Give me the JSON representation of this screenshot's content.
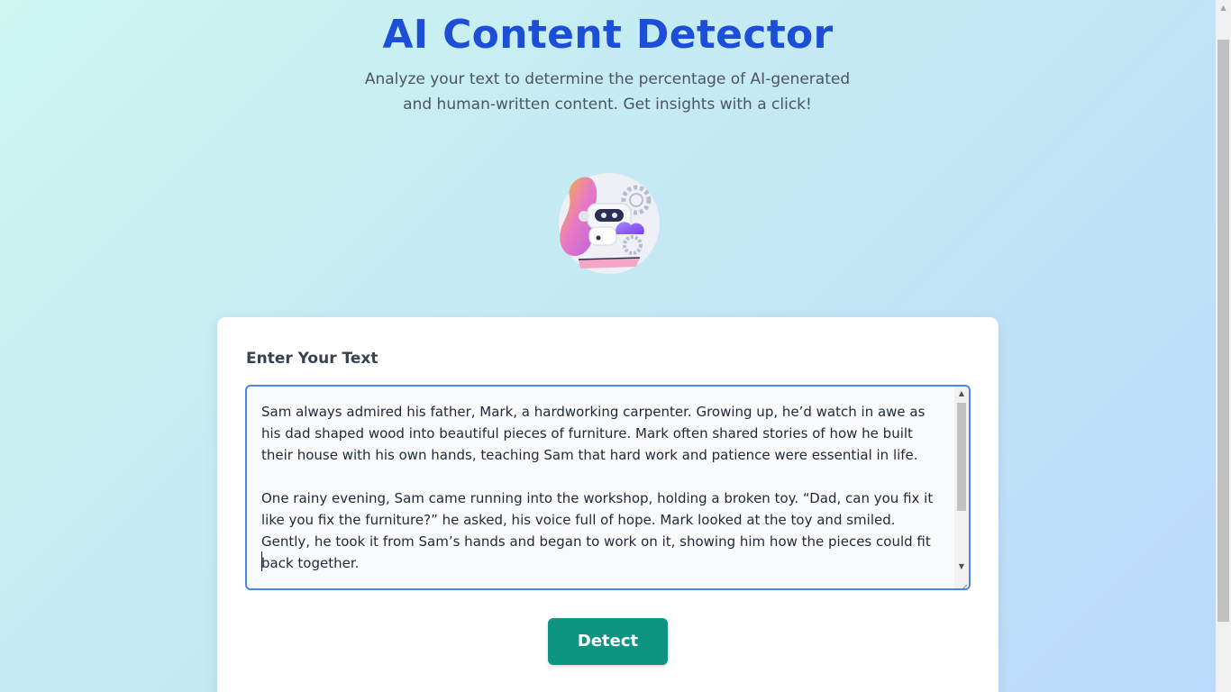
{
  "header": {
    "title": "AI Content Detector",
    "subtitle": "Analyze your text to determine the percentage of AI-generated and human-written content. Get insights with a click!"
  },
  "illustration": {
    "icon": "robot-illustration-icon"
  },
  "form": {
    "label": "Enter Your Text",
    "text_value": "Sam always admired his father, Mark, a hardworking carpenter. Growing up, he’d watch in awe as his dad shaped wood into beautiful pieces of furniture. Mark often shared stories of how he built their house with his own hands, teaching Sam that hard work and patience were essential in life.\n\nOne rainy evening, Sam came running into the workshop, holding a broken toy. “Dad, can you fix it like you fix the furniture?” he asked, his voice full of hope. Mark looked at the toy and smiled. Gently, he took it from Sam’s hands and began to work on it, showing him how the pieces could fit back together.\n\nAs the toy was restored, Sam’s eyes lit up. “You can fix anything, Dad.”",
    "detect_label": "Detect"
  },
  "colors": {
    "title": "#1d4ed8",
    "button": "#0e9483",
    "focus_border": "#4a86e8"
  }
}
